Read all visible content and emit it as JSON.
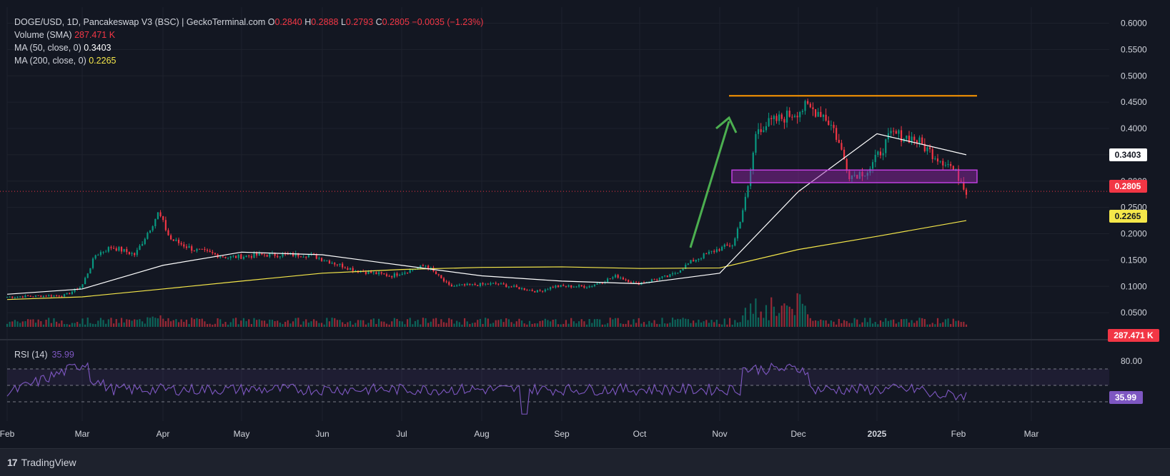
{
  "header": {
    "symbol": "DOGE/USD, 1D, Pancakeswap V3 (BSC) | GeckoTerminal.com",
    "o_label": "O",
    "o_value": "0.2840",
    "h_label": "H",
    "h_value": "0.2888",
    "l_label": "L",
    "l_value": "0.2793",
    "c_label": "C",
    "c_value": "0.2805",
    "change": "−0.0035 (−1.23%)",
    "volume_label": "Volume (SMA)",
    "volume_value": "287.471 K",
    "ma50_label": "MA (50, close, 0)",
    "ma50_value": "0.3403",
    "ma200_label": "MA (200, close, 0)",
    "ma200_value": "0.2265"
  },
  "rsi": {
    "label": "RSI (14)",
    "value": "35.99",
    "levels": [
      "80.00"
    ]
  },
  "price_axis": {
    "ticks": [
      "0.6000",
      "0.5500",
      "0.5000",
      "0.4500",
      "0.4000",
      "0.3500",
      "0.3000",
      "0.2500",
      "0.2000",
      "0.1500",
      "0.1000",
      "0.0500"
    ],
    "tick_values": [
      0.6,
      0.55,
      0.5,
      0.45,
      0.4,
      0.35,
      0.3,
      0.25,
      0.2,
      0.15,
      0.1,
      0.05
    ]
  },
  "time_axis": {
    "labels": [
      "Feb",
      "Mar",
      "Apr",
      "May",
      "Jun",
      "Jul",
      "Aug",
      "Sep",
      "Oct",
      "Nov",
      "Dec",
      "2025",
      "Feb",
      "Mar"
    ]
  },
  "badges": {
    "ma50": "0.3403",
    "last_price": "0.2805",
    "ma200": "0.2265",
    "volume": "287.471 K",
    "rsi": "35.99"
  },
  "branding": {
    "text": "TradingView"
  },
  "colors": {
    "up": "#089981",
    "down": "#f23645",
    "ma50": "#ffffff",
    "ma200": "#f5e74a",
    "rsi": "#7e57c2",
    "resistance": "#ff9800",
    "support_zone": "#9c27b0",
    "arrow": "#4caf50"
  },
  "chart_data": {
    "type": "line",
    "title": "DOGE/USD, 1D, Pancakeswap V3 (BSC) | GeckoTerminal.com",
    "x": [
      "Feb",
      "Mar",
      "Apr",
      "May",
      "Jun",
      "Jul",
      "Aug",
      "Sep",
      "Oct",
      "Nov",
      "Dec",
      "2025",
      "Feb"
    ],
    "series": [
      {
        "name": "DOGE/USD",
        "values": [
          0.08,
          0.14,
          0.18,
          0.15,
          0.16,
          0.12,
          0.11,
          0.1,
          0.11,
          0.15,
          0.42,
          0.33,
          0.28
        ]
      },
      {
        "name": "MA (50, close, 0)",
        "values": [
          0.085,
          0.095,
          0.14,
          0.165,
          0.16,
          0.14,
          0.12,
          0.11,
          0.105,
          0.125,
          0.28,
          0.39,
          0.35
        ]
      },
      {
        "name": "MA (200, close, 0)",
        "values": [
          0.075,
          0.08,
          0.095,
          0.11,
          0.125,
          0.132,
          0.136,
          0.137,
          0.134,
          0.135,
          0.17,
          0.195,
          0.225
        ]
      }
    ],
    "ylim": [
      0,
      0.6
    ],
    "last": {
      "open": 0.284,
      "high": 0.2888,
      "low": 0.2793,
      "close": 0.2805
    },
    "annotations": {
      "resistance": 0.462,
      "support_zone": [
        0.297,
        0.321
      ]
    }
  }
}
